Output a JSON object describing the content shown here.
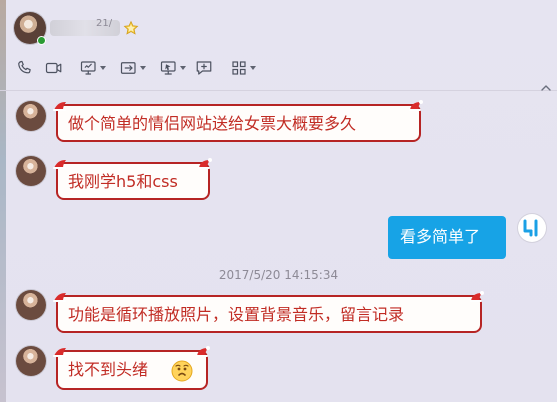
{
  "header": {
    "contact_name": "",
    "name_tail": "21/",
    "star_icon": "star-outline-icon",
    "toolbar": [
      {
        "icon": "phone-icon"
      },
      {
        "icon": "video-camera-icon"
      },
      {
        "icon": "screen-share-icon",
        "has_menu": true
      },
      {
        "icon": "forward-window-icon",
        "has_menu": true
      },
      {
        "icon": "remote-desktop-icon",
        "has_menu": true
      },
      {
        "icon": "chat-bubble-plus-icon"
      },
      {
        "icon": "apps-grid-icon",
        "has_menu": true
      }
    ]
  },
  "messages": [
    {
      "side": "left",
      "text": "做个简单的情侣网站送给女票大概要多久"
    },
    {
      "side": "left",
      "text": "我刚学h5和css"
    },
    {
      "side": "right",
      "text": "看多简单了"
    },
    {
      "side": "system",
      "text": "2017/5/20 14:15:34"
    },
    {
      "side": "left",
      "text": "功能是循环播放照片，设置背景音乐，留言记录"
    },
    {
      "side": "left",
      "text": "找不到头绪",
      "emoji": "worried-face-emoji-icon"
    }
  ],
  "colors": {
    "background": "#e6e4f1",
    "bubble_border": "#b62424",
    "bubble_text": "#c12c24",
    "self_bubble": "#17a3e6",
    "timestamp": "#8d8a96"
  }
}
